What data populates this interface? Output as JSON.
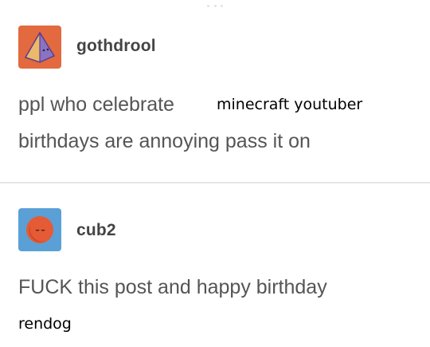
{
  "posts": [
    {
      "username": "gothdrool",
      "avatar_icon": "pyramid-icon",
      "avatar_color": "#e3693f",
      "text_line1": "ppl who celebrate",
      "overlay_text": "minecraft youtuber",
      "text_line2": "birthdays are annoying pass it on"
    },
    {
      "username": "cub2",
      "avatar_icon": "sleepy-face-icon",
      "avatar_color": "#5aa0d6",
      "text_line1": "FUCK this post and happy birthday",
      "overlay_text": "rendog"
    }
  ]
}
